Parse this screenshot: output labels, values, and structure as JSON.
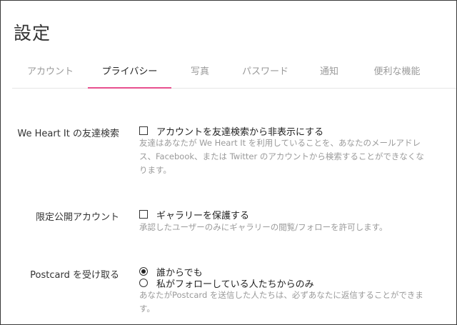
{
  "page": {
    "title": "設定"
  },
  "tabs": [
    {
      "label": "アカウント",
      "active": false
    },
    {
      "label": "プライバシー",
      "active": true
    },
    {
      "label": "写真",
      "active": false
    },
    {
      "label": "パスワード",
      "active": false
    },
    {
      "label": "通知",
      "active": false
    },
    {
      "label": "便利な機能",
      "active": false
    }
  ],
  "colors": {
    "accent": "#e8508f",
    "muted_text": "#9a9a9a"
  },
  "sections": {
    "friend_search": {
      "label": "We Heart It の友達検索",
      "option": {
        "label": "アカウントを友達検索から非表示にする",
        "checked": false
      },
      "help": "友達はあなたが We Heart It を利用していることを、あなたのメールアドレス、Facebook、または Twitter のアカウントから検索することができなくなります。"
    },
    "limited_account": {
      "label": "限定公開アカウント",
      "option": {
        "label": "ギャラリーを保護する",
        "checked": false
      },
      "help": "承認したユーザーのみにギャラリーの閲覧/フォローを許可します。"
    },
    "postcard": {
      "label": "Postcard を受け取る",
      "options": [
        {
          "label": "誰からでも",
          "checked": true
        },
        {
          "label": "私がフォローしている人たちからのみ",
          "checked": false
        }
      ],
      "help": "あなたがPostcard を送信した人たちは、必ずあなたに返信することができます。"
    }
  }
}
